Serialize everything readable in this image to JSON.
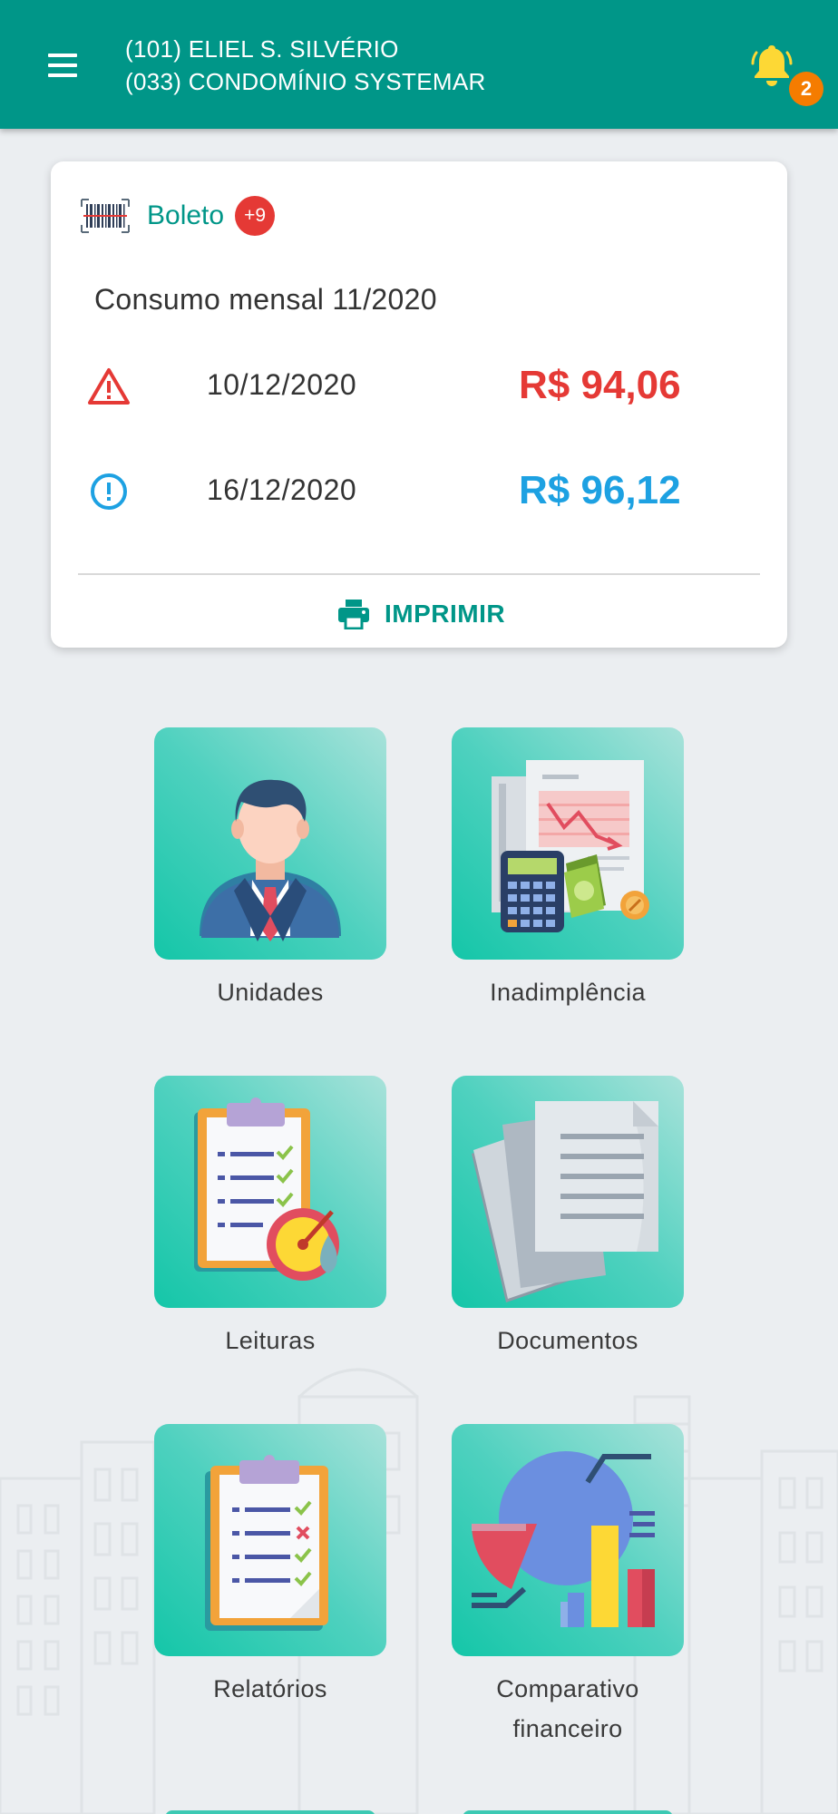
{
  "header": {
    "unit_line": "(101) ELIEL S. SILVÉRIO",
    "condo_line": "(033) CONDOMÍNIO SYSTEMAR",
    "notification_count": "2",
    "icons": {
      "menu": "hamburger-menu-icon",
      "bell": "bell-icon"
    },
    "colors": {
      "bar": "#009688",
      "bell": "#fdd835",
      "badge": "#f57c00"
    }
  },
  "boleto": {
    "title": "Boleto",
    "badge": "+9",
    "description": "Consumo mensal 11/2020",
    "entries": [
      {
        "icon": "warning-triangle-icon",
        "date": "10/12/2020",
        "value": "R$ 94,06",
        "status_color": "#e53935"
      },
      {
        "icon": "alert-circle-icon",
        "date": "16/12/2020",
        "value": "R$ 96,12",
        "status_color": "#1da1e2"
      }
    ],
    "print_label": "IMPRIMIR"
  },
  "menu": [
    {
      "label": "Unidades",
      "icon": "businessman-icon"
    },
    {
      "label": "Inadimplência",
      "icon": "debt-report-icon"
    },
    {
      "label": "Leituras",
      "icon": "meter-reading-clipboard-icon"
    },
    {
      "label": "Documentos",
      "icon": "documents-icon"
    },
    {
      "label": "Relatórios",
      "icon": "reports-clipboard-icon"
    },
    {
      "label": "Comparativo financeiro",
      "icon": "financial-chart-icon"
    }
  ]
}
